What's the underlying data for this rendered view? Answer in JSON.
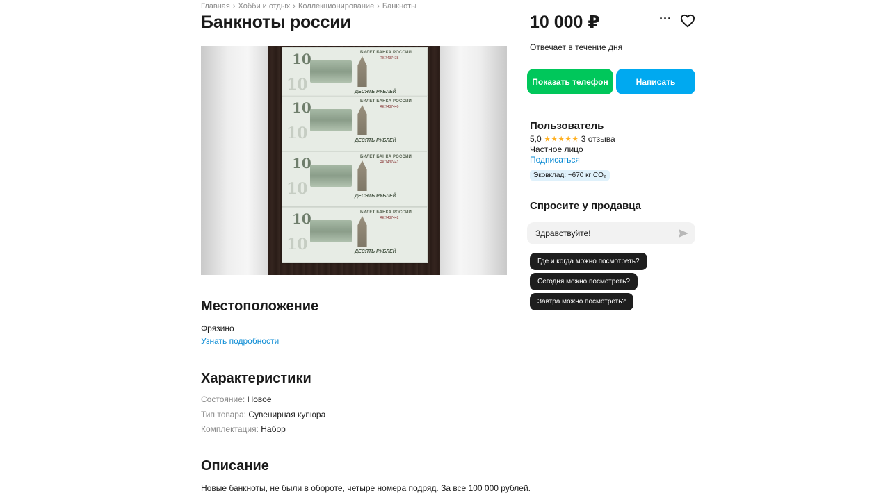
{
  "breadcrumbs": [
    "Главная",
    "Хобби и отдых",
    "Коллекционирование",
    "Банкноты"
  ],
  "title": "Банкноты россии",
  "price": "10 000 ₽",
  "reply_time": "Отвечает в течение дня",
  "actions": {
    "phone": "Показать телефон",
    "write": "Написать"
  },
  "seller": {
    "name": "Пользователь",
    "rating": "5,0",
    "reviews": "3 отзыва",
    "type": "Частное лицо",
    "subscribe": "Подписаться",
    "eco": "Эковклад: ~670 кг CO₂"
  },
  "ask": {
    "heading": "Спросите у продавца",
    "message": "Здравствуйте!",
    "chips": [
      "Где и когда можно посмотреть?",
      "Сегодня можно посмотреть?",
      "Завтра можно посмотреть?"
    ]
  },
  "photo": {
    "notes": [
      {
        "denomination": "10",
        "bank": "БИЛЕТ БАНКА РОССИИ",
        "label": "ДЕСЯТЬ РУБЛЕЙ",
        "serial": "ЯК 7437438"
      },
      {
        "denomination": "10",
        "bank": "БИЛЕТ БАНКА РОССИИ",
        "label": "ДЕСЯТЬ РУБЛЕЙ",
        "serial": "ЯК 7437440"
      },
      {
        "denomination": "10",
        "bank": "БИЛЕТ БАНКА РОССИИ",
        "label": "ДЕСЯТЬ РУБЛЕЙ",
        "serial": "ЯК 7437441"
      },
      {
        "denomination": "10",
        "bank": "БИЛЕТ БАНКА РОССИИ",
        "label": "ДЕСЯТЬ РУБЛЕЙ",
        "serial": "ЯК 7437442"
      }
    ]
  },
  "location": {
    "heading": "Местоположение",
    "city": "Фрязино",
    "details": "Узнать подробности"
  },
  "characteristics": {
    "heading": "Характеристики",
    "rows": [
      {
        "key": "Состояние:",
        "value": "Новое"
      },
      {
        "key": "Тип товара:",
        "value": "Сувенирная купюра"
      },
      {
        "key": "Комплектация:",
        "value": "Набор"
      }
    ]
  },
  "description": {
    "heading": "Описание",
    "text": "Новые банкноты, не были в обороте, четыре номера подряд. За все 100 000 рублей."
  },
  "colors": {
    "green": "#00c75b",
    "blue": "#00a9f0",
    "link": "#0a8bd4",
    "star": "#ffb021"
  }
}
